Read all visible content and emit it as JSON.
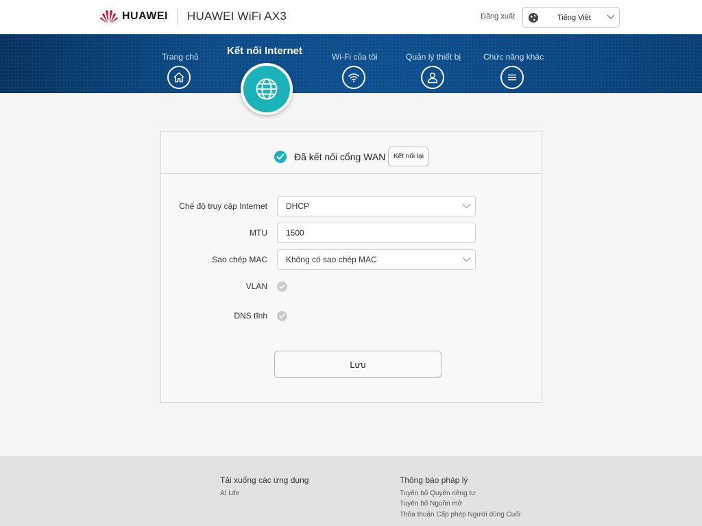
{
  "header": {
    "brand": "HUAWEI",
    "product": "HUAWEI WiFi AX3",
    "logout_label": "Đăng xuất",
    "language": "Tiếng Việt"
  },
  "nav": {
    "items": [
      {
        "label": "Trang chủ",
        "icon": "home-icon"
      },
      {
        "label": "Kết nối Internet",
        "icon": "globe-icon",
        "active": true
      },
      {
        "label": "Wi-Fi của tôi",
        "icon": "wifi-icon"
      },
      {
        "label": "Quản lý thiết bị",
        "icon": "user-icon"
      },
      {
        "label": "Chức năng khác",
        "icon": "menu-icon"
      }
    ]
  },
  "status": {
    "text": "Đã kết nối cổng WAN",
    "reconnect_label": "Kết nối lại"
  },
  "form": {
    "access_mode": {
      "label": "Chế độ truy cập Internet",
      "value": "DHCP"
    },
    "mtu": {
      "label": "MTU",
      "value": "1500"
    },
    "mac_clone": {
      "label": "Sao chép MAC",
      "value": "Không có sao chép MAC"
    },
    "vlan": {
      "label": "VLAN"
    },
    "static_dns": {
      "label": "DNS tĩnh"
    },
    "save_label": "Lưu"
  },
  "footer": {
    "apps_title": "Tải xuống các ứng dụng",
    "apps_link": "AI Life",
    "legal_title": "Thông báo pháp lý",
    "legal_links": [
      "Tuyên bố Quyền riêng tư",
      "Tuyên bố Nguồn mở",
      "Thỏa thuận Cấp phép Người dùng Cuối"
    ]
  },
  "colors": {
    "accent": "#19b3b9",
    "nav_bg": "#0d4b88",
    "brand_red": "#cf0a2c"
  }
}
